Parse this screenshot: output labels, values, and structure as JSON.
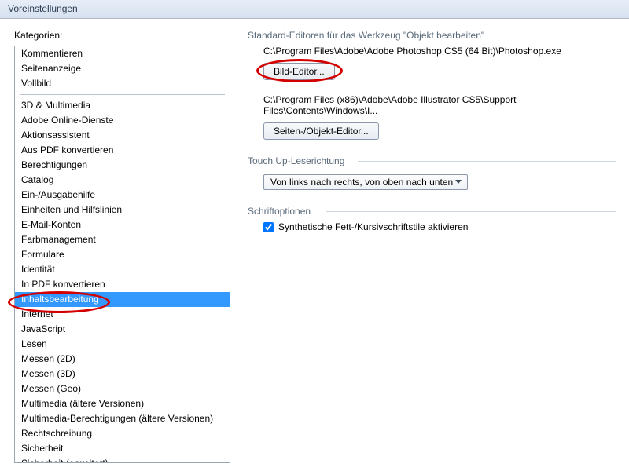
{
  "window": {
    "title": "Voreinstellungen"
  },
  "sidebar": {
    "label": "Kategorien:",
    "group1": [
      "Kommentieren",
      "Seitenanzeige",
      "Vollbild"
    ],
    "group2": [
      "3D & Multimedia",
      "Adobe Online-Dienste",
      "Aktionsassistent",
      "Aus PDF konvertieren",
      "Berechtigungen",
      "Catalog",
      "Ein-/Ausgabehilfe",
      "Einheiten und Hilfslinien",
      "E-Mail-Konten",
      "Farbmanagement",
      "Formulare",
      "Identität",
      "In PDF konvertieren",
      "Inhaltsbearbeitung",
      "Internet",
      "JavaScript",
      "Lesen",
      "Messen (2D)",
      "Messen (3D)",
      "Messen (Geo)",
      "Multimedia (ältere Versionen)",
      "Multimedia-Berechtigungen (ältere Versionen)",
      "Rechtschreibung",
      "Sicherheit",
      "Sicherheit (erweitert)"
    ],
    "selected": "Inhaltsbearbeitung"
  },
  "editors": {
    "heading": "Standard-Editoren für das Werkzeug \"Objekt bearbeiten\"",
    "image_path": "C:\\Program Files\\Adobe\\Adobe Photoshop CS5 (64 Bit)\\Photoshop.exe",
    "image_button": "Bild-Editor...",
    "page_path": "C:\\Program Files (x86)\\Adobe\\Adobe Illustrator CS5\\Support Files\\Contents\\Windows\\I...",
    "page_button": "Seiten-/Objekt-Editor..."
  },
  "touchup": {
    "heading": "Touch Up-Leserichtung",
    "value": "Von links nach rechts, von oben nach unten"
  },
  "fonts": {
    "heading": "Schriftoptionen",
    "checkbox_label": "Synthetische Fett-/Kursivschriftstile aktivieren",
    "checked": true
  }
}
